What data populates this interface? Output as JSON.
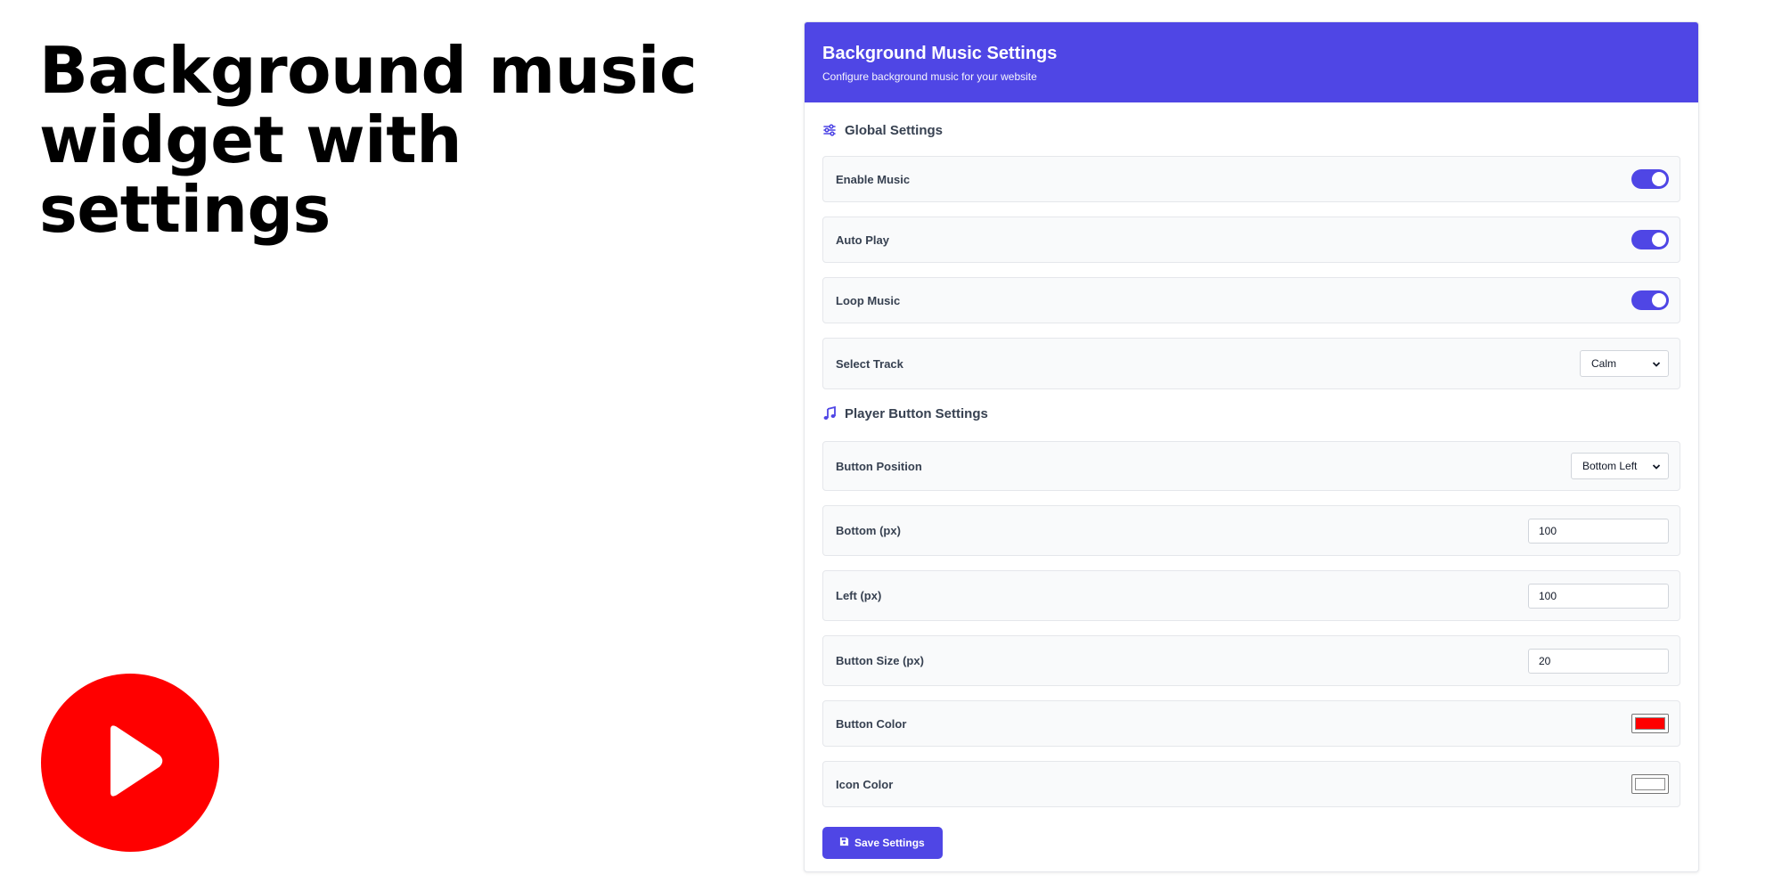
{
  "headline": {
    "line1": "Background music",
    "line2": "widget with settings"
  },
  "preview": {
    "icon": "play-icon",
    "button_color": "#ff0000",
    "icon_color": "#ffffff"
  },
  "panel": {
    "title": "Background Music Settings",
    "subtitle": "Configure background music for your website",
    "header_color": "#4f46e5"
  },
  "global_settings": {
    "heading": "Global Settings",
    "icon": "sliders-icon",
    "enable_music": {
      "label": "Enable Music",
      "on": true
    },
    "auto_play": {
      "label": "Auto Play",
      "on": true
    },
    "loop_music": {
      "label": "Loop Music",
      "on": true
    },
    "select_track": {
      "label": "Select Track",
      "value": "Calm"
    }
  },
  "player_settings": {
    "heading": "Player Button Settings",
    "icon": "music-note-icon",
    "button_position": {
      "label": "Button Position",
      "value": "Bottom Left"
    },
    "bottom": {
      "label": "Bottom (px)",
      "value": "100"
    },
    "left": {
      "label": "Left (px)",
      "value": "100"
    },
    "button_size": {
      "label": "Button Size (px)",
      "value": "20"
    },
    "button_color": {
      "label": "Button Color",
      "value": "#ff0000"
    },
    "icon_color": {
      "label": "Icon Color",
      "value": "#ffffff"
    }
  },
  "save_button": {
    "label": "Save Settings",
    "icon": "save-icon"
  }
}
